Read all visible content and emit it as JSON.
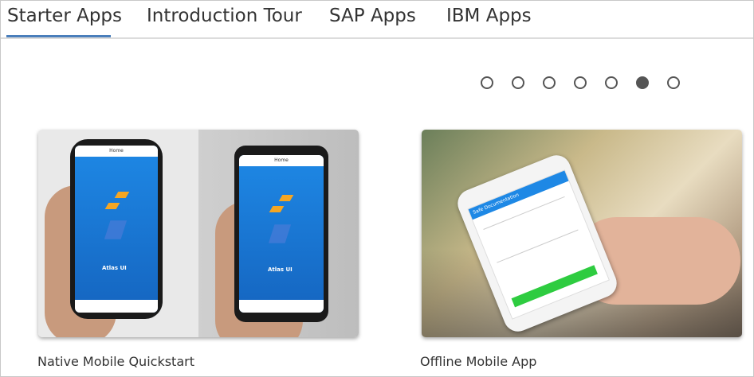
{
  "tabs": [
    {
      "label": "Starter Apps",
      "active": true
    },
    {
      "label": "Introduction Tour",
      "active": false
    },
    {
      "label": "SAP Apps",
      "active": false
    },
    {
      "label": "IBM Apps",
      "active": false
    }
  ],
  "carousel": {
    "page_count": 7,
    "active_index": 5
  },
  "cards": [
    {
      "caption": "Native Mobile Quickstart",
      "phone_title": "Home",
      "app_name": "Atlas UI"
    },
    {
      "caption": "Offline Mobile App",
      "phone_title": "Safe Documentation"
    }
  ],
  "colors": {
    "accent": "#4a7ebb",
    "app_blue": "#1e88e5",
    "app_green": "#2ecc40"
  }
}
